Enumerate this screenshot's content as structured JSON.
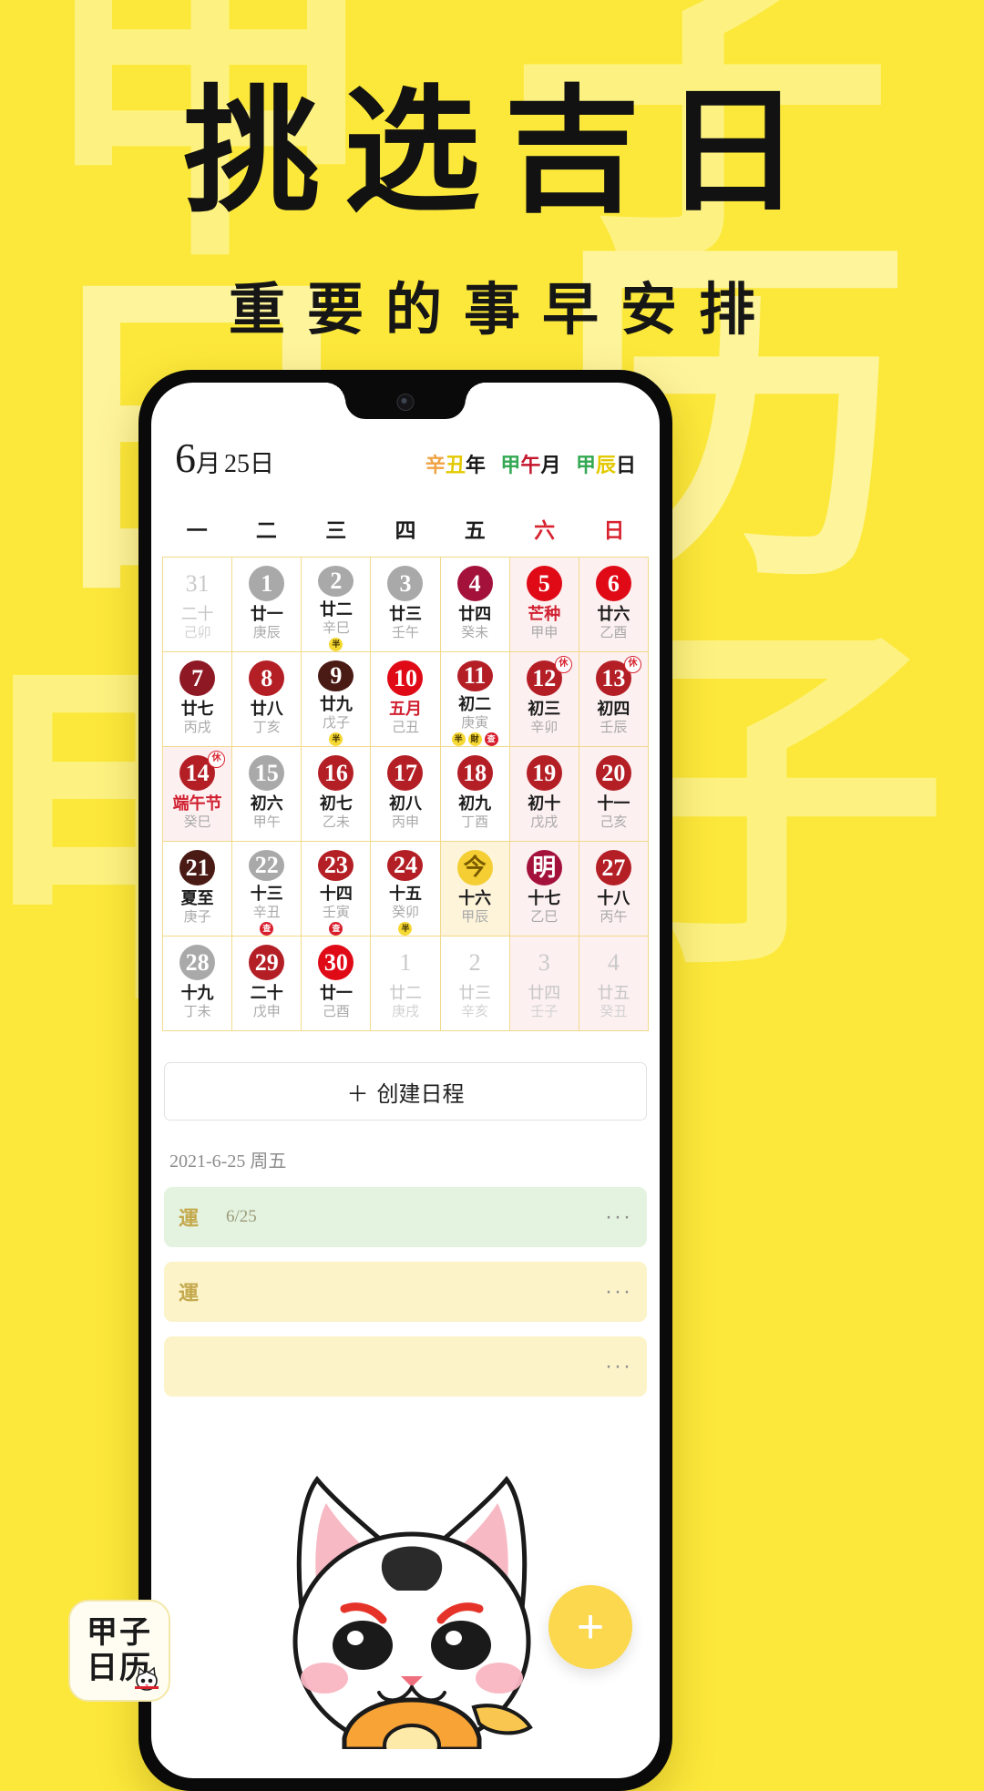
{
  "poster": {
    "headline": "挑选吉日",
    "subline": "重要的事早安排",
    "background_color": "#FCE83A",
    "ghost_chars": [
      "甲",
      "子",
      "日",
      "历",
      "甲",
      "子"
    ]
  },
  "app": {
    "header": {
      "month": "6",
      "month_unit": "月",
      "day": "25",
      "day_unit": "日",
      "ganzhi": [
        {
          "a": "辛",
          "b": "丑",
          "suffix": "年",
          "color_a": "#F0A243",
          "color_b": "#E3C900"
        },
        {
          "a": "甲",
          "b": "午",
          "suffix": "月",
          "color_a": "#34A853",
          "color_b": "#C4162F"
        },
        {
          "a": "甲",
          "b": "辰",
          "suffix": "日",
          "color_a": "#34A853",
          "color_b": "#E3C900"
        }
      ]
    },
    "weekdays": [
      "一",
      "二",
      "三",
      "四",
      "五",
      "六",
      "日"
    ],
    "weekend_color": "#D8232F",
    "create_button": {
      "icon": "plus-icon",
      "label": "创建日程"
    },
    "schedule": {
      "date_label": "2021-6-25 周五",
      "events": [
        {
          "tag": "運",
          "time": "6/25",
          "title": "",
          "style": "green",
          "more": "···"
        },
        {
          "tag": "運",
          "time": "",
          "title": "",
          "style": "yellowish",
          "more": "···"
        },
        {
          "tag": "",
          "time": "",
          "title": "",
          "style": "yellowish",
          "more": "···"
        }
      ]
    },
    "fab": {
      "icon": "plus-icon",
      "label": "+"
    },
    "calendar": {
      "weeks": [
        [
          {
            "day": "31",
            "lunar": "二十",
            "gz": "己卯",
            "style": "plain",
            "dim": true
          },
          {
            "day": "1",
            "lunar": "廿一",
            "gz": "庚辰",
            "style": "grey"
          },
          {
            "day": "2",
            "lunar": "廿二",
            "gz": "辛巳",
            "style": "grey",
            "badges": [
              {
                "t": "半",
                "c": "y"
              }
            ]
          },
          {
            "day": "3",
            "lunar": "廿三",
            "gz": "壬午",
            "style": "grey"
          },
          {
            "day": "4",
            "lunar": "廿四",
            "gz": "癸未",
            "style": "crimson"
          },
          {
            "day": "5",
            "lunar": "芒种",
            "gz": "甲申",
            "style": "brightred",
            "weekend": true,
            "festival": true
          },
          {
            "day": "6",
            "lunar": "廿六",
            "gz": "乙酉",
            "style": "brightred",
            "weekend": true
          }
        ],
        [
          {
            "day": "7",
            "lunar": "廿七",
            "gz": "丙戌",
            "style": "maroon"
          },
          {
            "day": "8",
            "lunar": "廿八",
            "gz": "丁亥",
            "style": "red"
          },
          {
            "day": "9",
            "lunar": "廿九",
            "gz": "戊子",
            "style": "brown",
            "badges": [
              {
                "t": "半",
                "c": "y"
              }
            ]
          },
          {
            "day": "10",
            "lunar": "五月",
            "gz": "己丑",
            "style": "brightred",
            "lunar_red": true
          },
          {
            "day": "11",
            "lunar": "初二",
            "gz": "庚寅",
            "style": "red",
            "badges": [
              {
                "t": "半",
                "c": "y"
              },
              {
                "t": "財",
                "c": "y"
              },
              {
                "t": "查",
                "c": "r"
              }
            ]
          },
          {
            "day": "12",
            "lunar": "初三",
            "gz": "辛卯",
            "style": "red",
            "weekend": true,
            "rest": "休"
          },
          {
            "day": "13",
            "lunar": "初四",
            "gz": "壬辰",
            "style": "red",
            "weekend": true,
            "rest": "休"
          }
        ],
        [
          {
            "day": "14",
            "lunar": "端午节",
            "gz": "癸巳",
            "style": "red",
            "weekend": true,
            "rest": "休",
            "festival": true
          },
          {
            "day": "15",
            "lunar": "初六",
            "gz": "甲午",
            "style": "grey"
          },
          {
            "day": "16",
            "lunar": "初七",
            "gz": "乙未",
            "style": "red"
          },
          {
            "day": "17",
            "lunar": "初八",
            "gz": "丙申",
            "style": "red"
          },
          {
            "day": "18",
            "lunar": "初九",
            "gz": "丁酉",
            "style": "red"
          },
          {
            "day": "19",
            "lunar": "初十",
            "gz": "戊戌",
            "style": "red",
            "weekend": true
          },
          {
            "day": "20",
            "lunar": "十一",
            "gz": "己亥",
            "style": "red",
            "weekend": true
          }
        ],
        [
          {
            "day": "21",
            "lunar": "夏至",
            "gz": "庚子",
            "style": "brown"
          },
          {
            "day": "22",
            "lunar": "十三",
            "gz": "辛丑",
            "style": "grey",
            "badges": [
              {
                "t": "查",
                "c": "r"
              }
            ]
          },
          {
            "day": "23",
            "lunar": "十四",
            "gz": "壬寅",
            "style": "red",
            "badges": [
              {
                "t": "查",
                "c": "r"
              }
            ]
          },
          {
            "day": "24",
            "lunar": "十五",
            "gz": "癸卯",
            "style": "red",
            "badges": [
              {
                "t": "半",
                "c": "y"
              }
            ]
          },
          {
            "day": "今",
            "lunar": "十六",
            "gz": "甲辰",
            "style": "today-b",
            "today": true
          },
          {
            "day": "明",
            "lunar": "十七",
            "gz": "乙巳",
            "style": "ming",
            "weekend": true
          },
          {
            "day": "27",
            "lunar": "十八",
            "gz": "丙午",
            "style": "red",
            "weekend": true
          }
        ],
        [
          {
            "day": "28",
            "lunar": "十九",
            "gz": "丁未",
            "style": "grey"
          },
          {
            "day": "29",
            "lunar": "二十",
            "gz": "戊申",
            "style": "red"
          },
          {
            "day": "30",
            "lunar": "廿一",
            "gz": "己酉",
            "style": "brightred"
          },
          {
            "day": "1",
            "lunar": "廿二",
            "gz": "庚戌",
            "style": "plain",
            "dim": true
          },
          {
            "day": "2",
            "lunar": "廿三",
            "gz": "辛亥",
            "style": "plain",
            "dim": true
          },
          {
            "day": "3",
            "lunar": "廿四",
            "gz": "壬子",
            "style": "plain",
            "dim": true,
            "weekend": true
          },
          {
            "day": "4",
            "lunar": "廿五",
            "gz": "癸丑",
            "style": "plain",
            "dim": true,
            "weekend": true
          }
        ]
      ]
    }
  },
  "logo": {
    "line1": "甲子",
    "line2": "日历"
  }
}
